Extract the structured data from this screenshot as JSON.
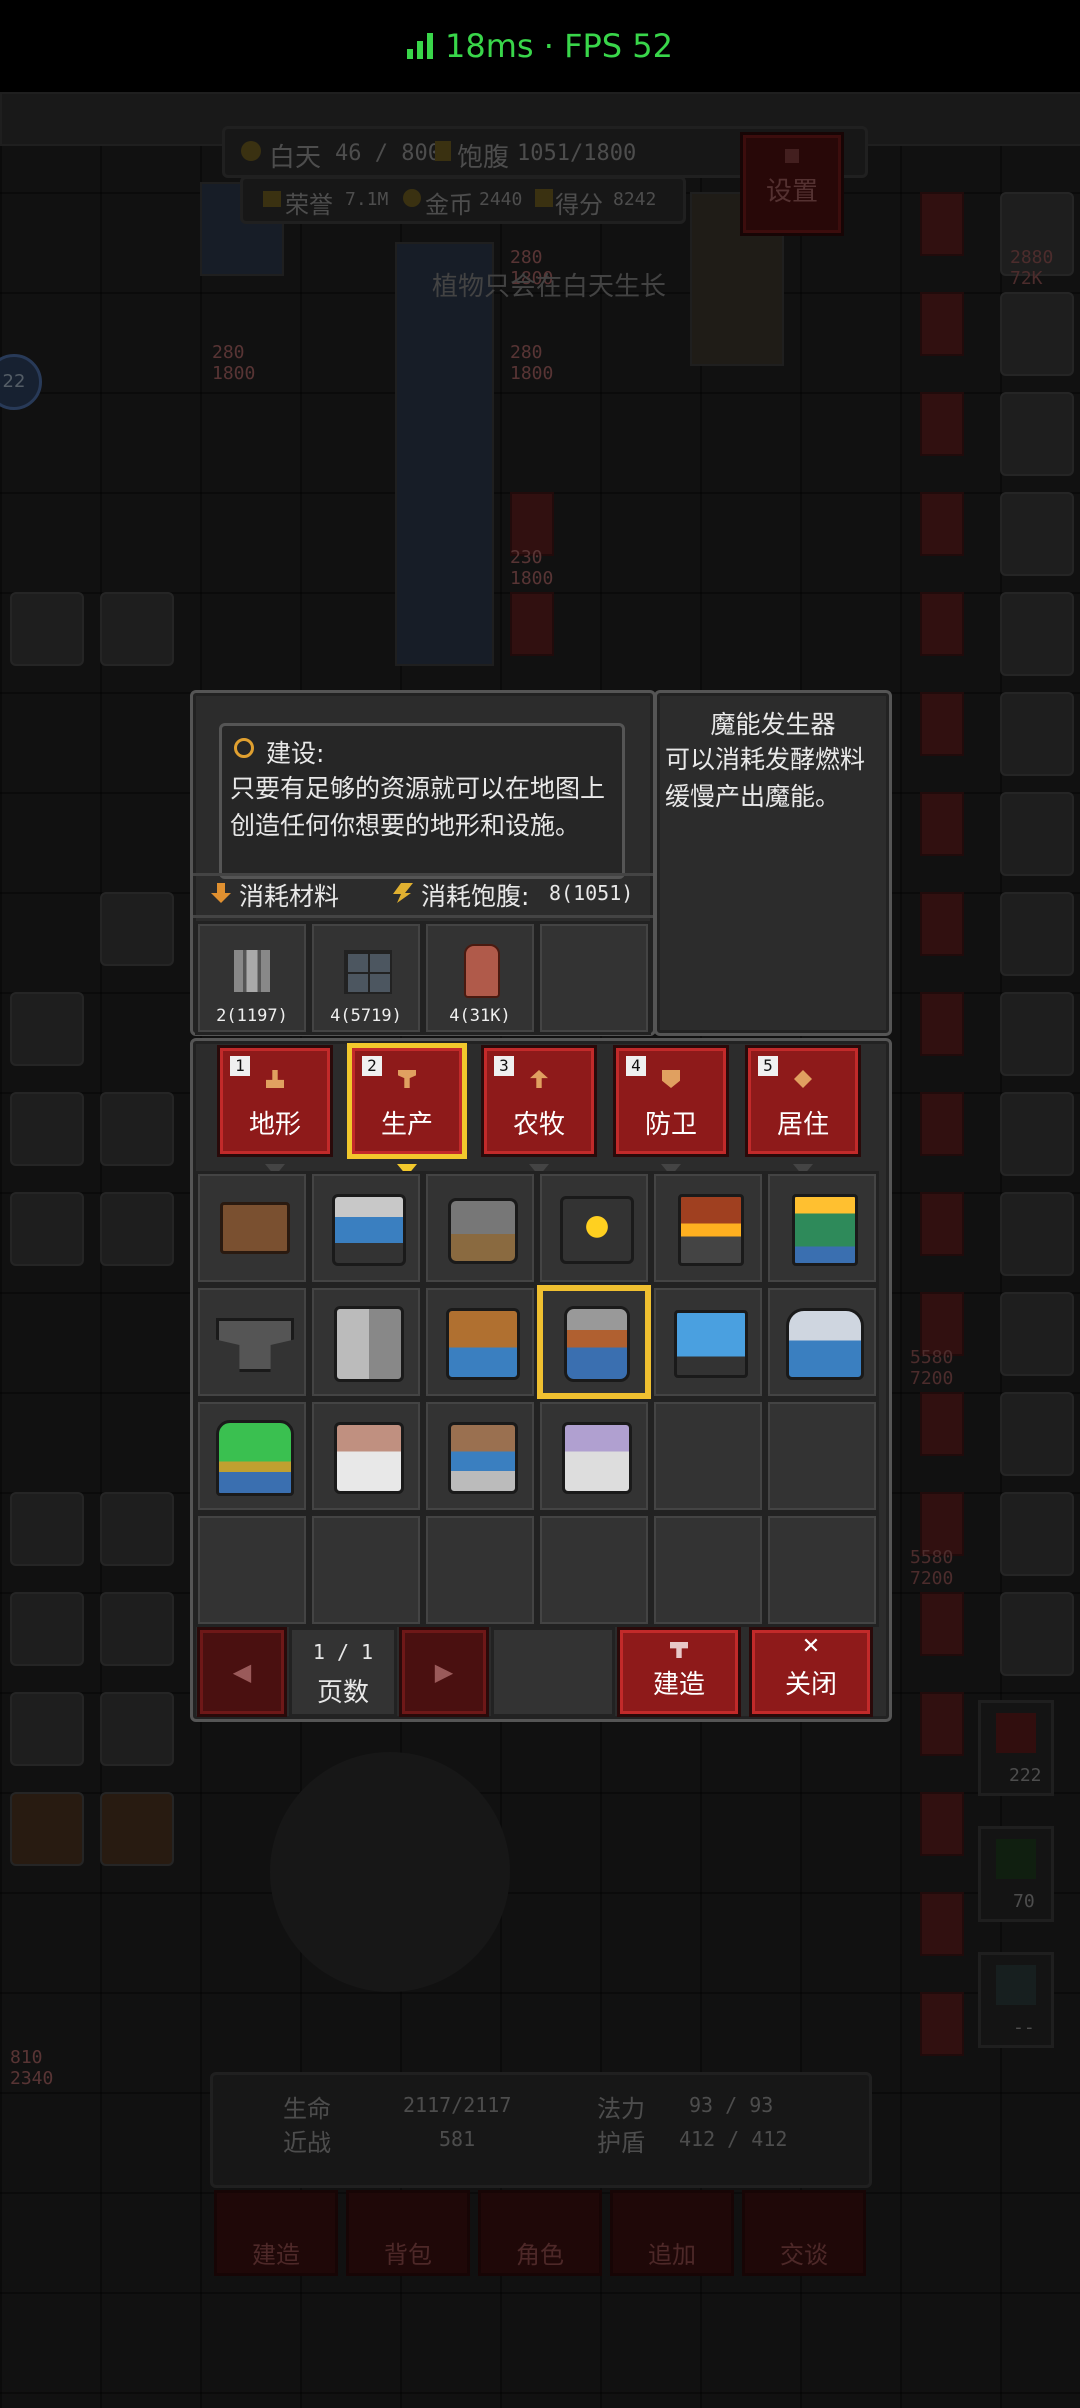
{
  "status_bar": {
    "text": "18ms · FPS 52"
  },
  "hud": {
    "day_label": "白天",
    "day_value": "46 / 800",
    "satiety_label": "饱腹",
    "satiety_value": "1051/1800",
    "honor_label": "荣誉",
    "honor_value": "7.1M",
    "gold_label": "金币",
    "gold_value": "2440",
    "score_label": "得分",
    "score_value": "8242",
    "settings_label": "设置",
    "hint": "植物只会在白天生长",
    "level_badge": "22"
  },
  "world_labels": {
    "npc1_stats": "280\n1800",
    "npc2_stats": "280\n1800",
    "npc3_stats": "280\n1800",
    "npc4_stats": "230\n1800",
    "tower_stats": "2880\n72K",
    "turret1_stats": "5580\n7200",
    "turret2_stats": "5580\n7200",
    "player_stats": "810\n2340"
  },
  "build_dialog": {
    "info_title": "建设:",
    "info_text": "只要有足够的资源就可以在地图上创造任何你想要的地形和设施。",
    "cost_materials_label": "消耗材料",
    "cost_satiety_label": "消耗饱腹:",
    "cost_satiety_value": "8(1051)",
    "materials": [
      {
        "icon": "stone-pillar-icon",
        "label": "2(1197)"
      },
      {
        "icon": "stone-brick-icon",
        "label": "4(5719)"
      },
      {
        "icon": "wood-log-icon",
        "label": "4(31K)"
      },
      {
        "icon": "",
        "label": ""
      }
    ],
    "detail_title": "魔能发生器",
    "detail_text": "可以消耗发酵燃料缓慢产出魔能。",
    "tabs": [
      {
        "num": "1",
        "label": "地形",
        "icon": "terrain-icon"
      },
      {
        "num": "2",
        "label": "生产",
        "icon": "anvil-icon"
      },
      {
        "num": "3",
        "label": "农牧",
        "icon": "sprout-icon"
      },
      {
        "num": "4",
        "label": "防卫",
        "icon": "shield-icon"
      },
      {
        "num": "5",
        "label": "居住",
        "icon": "house-icon"
      }
    ],
    "selected_tab": 1,
    "selected_item": 9,
    "items": [
      "workbench-icon",
      "sawmill-icon",
      "stone-cutter-icon",
      "furnace-icon",
      "smelter-icon",
      "kiln-icon",
      "anvil-icon",
      "loom-icon",
      "tanner-icon",
      "mana-generator-icon",
      "glass-press-icon",
      "distiller-icon",
      "fermenter-icon",
      "alchemy-table-icon",
      "refinery-icon",
      "crystal-forge-icon"
    ],
    "page_value": "1 / 1",
    "page_label": "页数",
    "prev_label": "◀",
    "next_label": "▶",
    "build_label": "建造",
    "close_label": "关闭"
  },
  "player_panel": {
    "hp_label": "生命",
    "hp_value": "2117/2117",
    "mana_label": "法力",
    "mana_value": "93 / 93",
    "melee_label": "近战",
    "melee_value": "581",
    "shield_label": "护盾",
    "shield_value": "412 / 412",
    "buttons": [
      "建造",
      "背包",
      "角色",
      "追加",
      "交谈"
    ]
  },
  "skills": [
    {
      "icon": "sword-skill-icon",
      "count": "222"
    },
    {
      "icon": "eye-skill-icon",
      "count": "70"
    },
    {
      "icon": "shield-skill-icon",
      "count": "--"
    }
  ],
  "colors": {
    "accent_green": "#39d64a",
    "button_red": "#8e1a1a",
    "highlight_gold": "#f2c82c"
  }
}
